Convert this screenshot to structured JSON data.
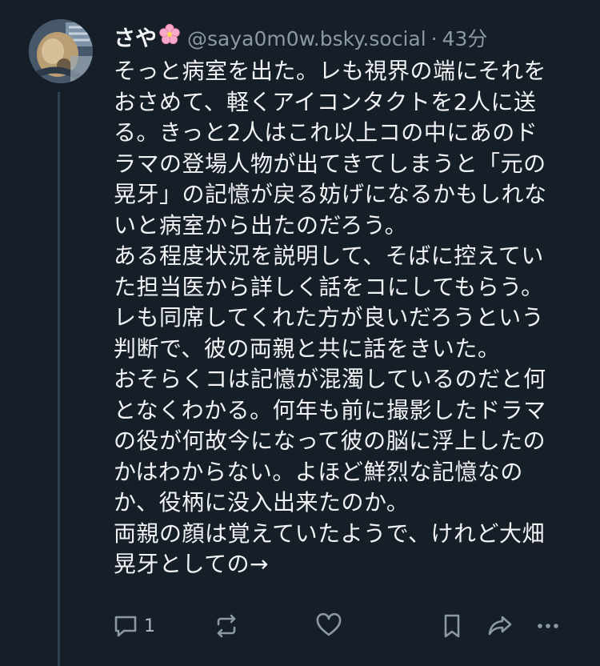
{
  "post": {
    "author_name": "さや",
    "handle": "@saya0m0w.bsky.social",
    "separator": "·",
    "time": "43分",
    "text": "そっと病室を出た。レも視界の端にそれを\nおさめて、軽くアイコンタクトを2人に送\nる。きっと2人はこれ以上コの中にあのド\nラマの登場人物が出てきてしまうと「元の\n晃牙」の記憶が戻る妨げになるかもしれな\nいと病室から出たのだろう。\nある程度状況を説明して、そばに控えてい\nた担当医から詳しく話をコにしてもらう。\nレも同席してくれた方が良いだろうという\n判断で、彼の両親と共に話をきいた。\nおそらくコは記憶が混濁しているのだと何\nとなくわかる。何年も前に撮影したドラマ\nの役が何故今になって彼の脳に浮上したの\nかはわからない。よほど鮮烈な記憶なの\nか、役柄に没入出来たのか。\n両親の顔は覚えていたようで、けれど大畑\n晃牙としての→"
  },
  "actions": {
    "reply_count": "1"
  },
  "icons": [
    "avatar",
    "cherry-blossom-icon",
    "reply-icon",
    "repost-icon",
    "like-icon",
    "bookmark-icon",
    "share-icon",
    "more-icon"
  ],
  "colors": {
    "background": "#161e27",
    "text": "#f1f3f5",
    "muted": "#8b98a5",
    "thread_line": "#2e4052"
  }
}
